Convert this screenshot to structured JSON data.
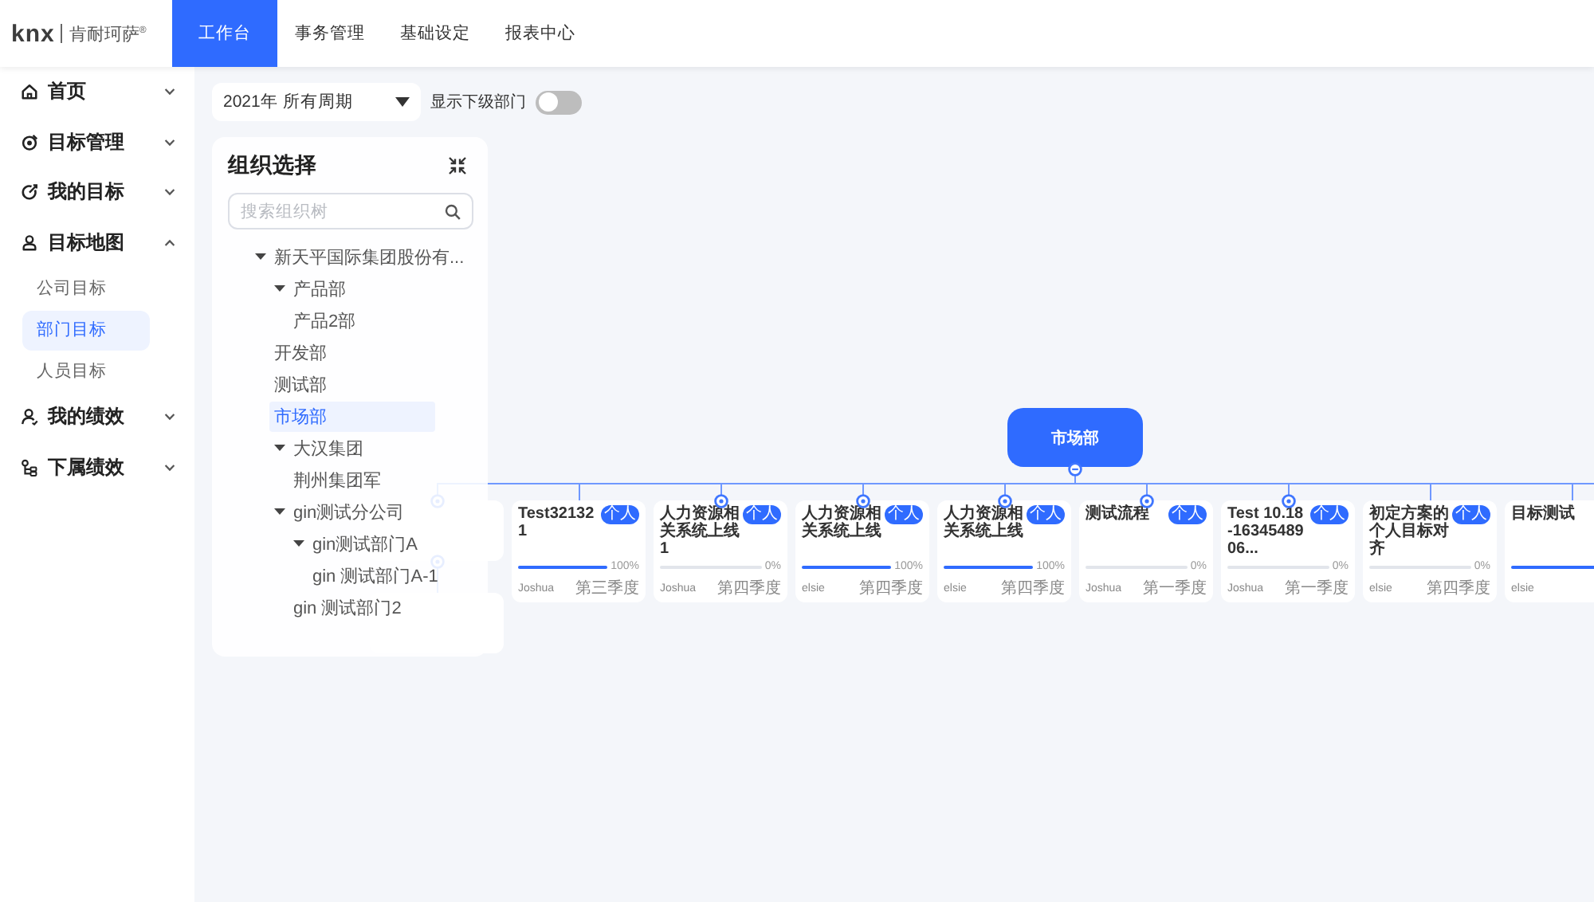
{
  "header": {
    "logo": {
      "wordmark": "knx",
      "name": "肯耐珂萨$^{®}$"
    },
    "nav": [
      {
        "label": "工作台",
        "selected": true
      },
      {
        "label": "事务管理",
        "selected": false
      },
      {
        "label": "基础设定",
        "selected": false
      },
      {
        "label": "报表中心",
        "selected": false
      }
    ]
  },
  "sidebar": {
    "items": [
      {
        "label": "首页",
        "expanded": false
      },
      {
        "label": "目标管理",
        "expanded": false
      },
      {
        "label": "我的目标",
        "expanded": false
      },
      {
        "label": "目标地图",
        "expanded": true,
        "children": [
          {
            "label": "公司目标",
            "selected": false
          },
          {
            "label": "部门目标",
            "selected": true
          },
          {
            "label": "人员目标",
            "selected": false
          }
        ]
      },
      {
        "label": "我的绩效",
        "expanded": false
      },
      {
        "label": "下属绩效",
        "expanded": false
      }
    ]
  },
  "toolbar": {
    "period_select": {
      "value": "2021年 所有周期"
    },
    "show_sub_departments": {
      "label": "显示下级部门",
      "on": false
    }
  },
  "org_panel": {
    "title": "组织选择",
    "search": {
      "placeholder": "搜索组织树"
    },
    "tree": [
      {
        "label": "新天平国际集团股份有...",
        "expanded": true,
        "selected": false,
        "children": [
          {
            "label": "产品部",
            "expanded": true,
            "selected": false,
            "children": [
              {
                "label": "产品2部",
                "selected": false
              }
            ]
          },
          {
            "label": "开发部",
            "selected": false
          },
          {
            "label": "测试部",
            "selected": false
          },
          {
            "label": "市场部",
            "selected": true
          },
          {
            "label": "大汉集团",
            "expanded": true,
            "selected": false,
            "children": [
              {
                "label": "荆州集团军",
                "selected": false
              }
            ]
          },
          {
            "label": "gin测试分公司",
            "expanded": true,
            "selected": false,
            "children": [
              {
                "label": "gin测试部门A",
                "expanded": true,
                "selected": false,
                "children": [
                  {
                    "label": "gin 测试部门A-1",
                    "selected": false
                  }
                ]
              },
              {
                "label": "gin 测试部门2",
                "selected": false
              }
            ]
          }
        ]
      }
    ]
  },
  "goal_map": {
    "root": {
      "label": "市场部",
      "expanded": true
    },
    "nodes": [
      {
        "marker": true,
        "expanded": true,
        "children": [
          {
            "marker": false
          }
        ]
      },
      {
        "title": "Test321321",
        "tag": "个人",
        "level": 1,
        "percent": "100%",
        "owner": "Joshua",
        "period": "第三季度",
        "marker": false
      },
      {
        "title": "人力资源相关系统上线1",
        "tag": "个人",
        "level": 0,
        "percent": "0%",
        "owner": "Joshua",
        "period": "第四季度",
        "marker": true
      },
      {
        "title": "人力资源相关系统上线",
        "tag": "个人",
        "level": 1,
        "percent": "100%",
        "owner": "elsie",
        "period": "第四季度",
        "marker": true
      },
      {
        "title": "人力资源相关系统上线",
        "tag": "个人",
        "level": 1,
        "percent": "100%",
        "owner": "elsie",
        "period": "第四季度",
        "marker": true
      },
      {
        "title": "测试流程",
        "tag": "个人",
        "level": 0,
        "percent": "0%",
        "owner": "Joshua",
        "period": "第一季度",
        "marker": true
      },
      {
        "title": "Test 10.18-1634548906...",
        "tag": "个人",
        "level": 0,
        "percent": "0%",
        "owner": "Joshua",
        "period": "第一季度",
        "marker": true
      },
      {
        "title": "初定方案的个人目标对齐",
        "tag": "个人",
        "level": 0,
        "percent": "0%",
        "owner": "elsie",
        "period": "第四季度",
        "marker": false
      },
      {
        "title": "目标测试",
        "level": 1,
        "owner": "elsie",
        "marker": false
      }
    ]
  }
}
